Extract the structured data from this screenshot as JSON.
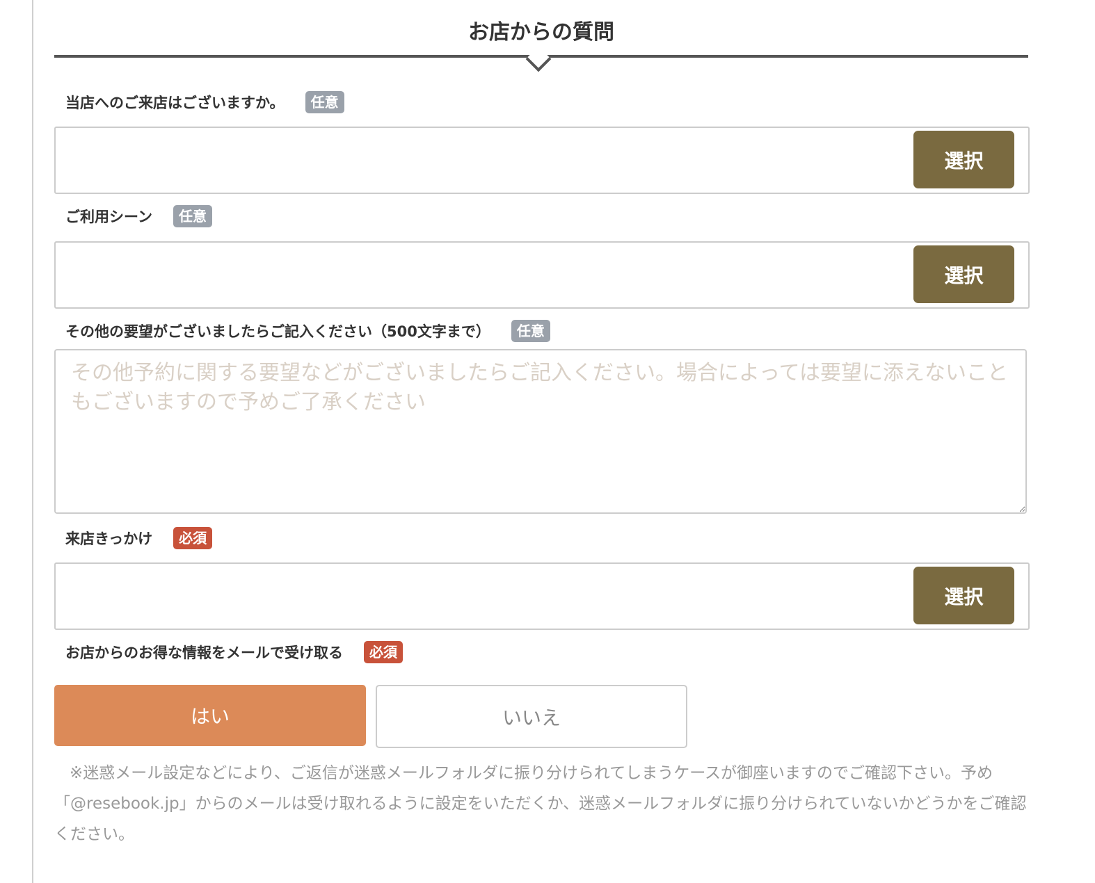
{
  "section": {
    "title": "お店からの質問"
  },
  "badges": {
    "optional": "任意",
    "required": "必須"
  },
  "fields": {
    "visit_history": {
      "label": "当店へのご来店はございますか。",
      "button": "選択"
    },
    "usage_scene": {
      "label": "ご利用シーン",
      "button": "選択"
    },
    "requests": {
      "label": "その他の要望がございましたらご記入ください（500文字まで）",
      "placeholder": "その他予約に関する要望などがございましたらご記入ください。場合によっては要望に添えないこともございますので予めご了承ください",
      "value": ""
    },
    "visit_reason": {
      "label": "来店きっかけ",
      "button": "選択"
    },
    "newsletter": {
      "label": "お店からのお得な情報をメールで受け取る",
      "yes": "はい",
      "no": "いいえ",
      "selected": "はい"
    }
  },
  "notice": "※迷惑メール設定などにより、ご返信が迷惑メールフォルダに振り分けられてしまうケースが御座いますのでご確認下さい。予め「@resebook.jp」からのメールは受け取れるように設定をいただくか、迷惑メールフォルダに振り分けられていないかどうかをご確認ください。",
  "colors": {
    "select_button": "#7a6a40",
    "yes_selected": "#dc8a58",
    "badge_optional": "#9aa1aa",
    "badge_required": "#c8523a"
  }
}
